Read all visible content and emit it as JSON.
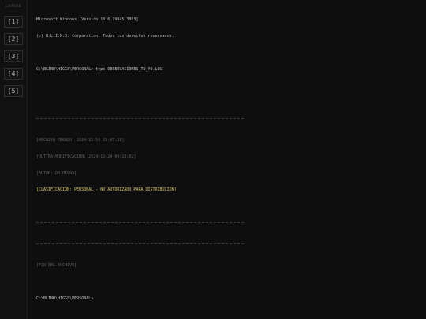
{
  "sidebar": {
    "title": "LAYERS",
    "buttons": [
      {
        "label": "[1]"
      },
      {
        "label": "[2]"
      },
      {
        "label": "[3]"
      },
      {
        "label": "[4]"
      },
      {
        "label": "[5]"
      }
    ]
  },
  "terminal": {
    "header_line1": "Microsoft Windows [Versión 10.0.19045.3803]",
    "header_line2": "(c) B.L.I.N.D. Corporation. Todos los derechos reservados.",
    "command_line": "C:\\BLIND\\HIGGS\\PERSONAL> type OBSERVACIONES_TU_YO.LOG",
    "meta_created": "[ARCHIVO CREADO: 2024-12-10 03:07:22]",
    "meta_modified": "[ÚLTIMA MODIFICACIÓN: 2024-12-24 04:13:02]",
    "meta_author": "[AUTOR: DR HIGGS]",
    "classification": "[CLASIFICACIÓN: PERSONAL - NO AUTORIZADO PARA DISTRIBUCIÓN]",
    "end_of_file": "[FIN DEL ARCHIVO]",
    "final_prompt": "C:\\BLIND\\HIGGS\\PERSONAL>"
  },
  "colors": {
    "background": "#0e0e0e",
    "text": "#bdbdbd",
    "dim_text": "#5e5e5e",
    "classification": "#d6c46a"
  }
}
